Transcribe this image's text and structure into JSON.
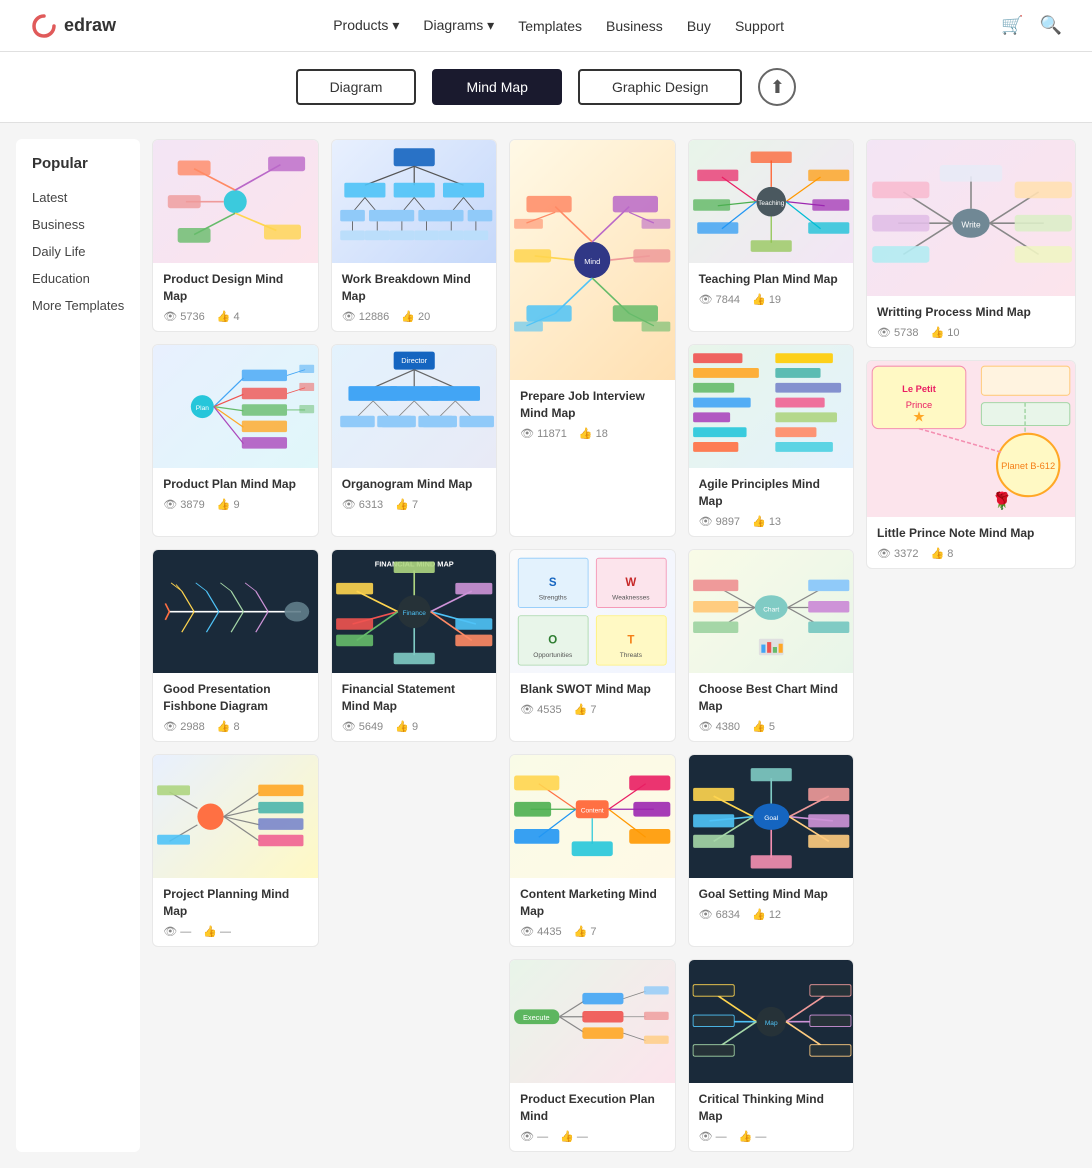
{
  "header": {
    "logo_text": "edraw",
    "nav_items": [
      {
        "label": "Products",
        "has_arrow": true
      },
      {
        "label": "Diagrams",
        "has_arrow": true
      },
      {
        "label": "Templates",
        "has_arrow": false
      },
      {
        "label": "Business",
        "has_arrow": false
      },
      {
        "label": "Buy",
        "has_arrow": false
      },
      {
        "label": "Support",
        "has_arrow": false
      }
    ]
  },
  "tabs": [
    {
      "label": "Diagram",
      "active": false
    },
    {
      "label": "Mind Map",
      "active": true
    },
    {
      "label": "Graphic Design",
      "active": false
    }
  ],
  "sidebar": {
    "title": "Popular",
    "items": [
      {
        "label": "Latest"
      },
      {
        "label": "Business"
      },
      {
        "label": "Daily Life"
      },
      {
        "label": "Education"
      },
      {
        "label": "More Templates"
      }
    ]
  },
  "cards": [
    {
      "id": "work-breakdown",
      "title": "Work Breakdown Mind Map",
      "views": "12886",
      "likes": "20",
      "thumb_type": "work",
      "col": 2
    },
    {
      "id": "prepare-job",
      "title": "Prepare Job Interview Mind Map",
      "views": "11871",
      "likes": "18",
      "thumb_type": "interview",
      "col": 3,
      "tall": true
    },
    {
      "id": "teaching-plan",
      "title": "Teaching Plan Mind Map",
      "views": "7844",
      "likes": "19",
      "thumb_type": "teaching",
      "col": 4
    },
    {
      "id": "agile-principles",
      "title": "Agile Principles Mind Map",
      "views": "9897",
      "likes": "13",
      "thumb_type": "agile",
      "col": 5
    },
    {
      "id": "product-design",
      "title": "Product Design Mind Map",
      "views": "5736",
      "likes": "4",
      "thumb_type": "product-design",
      "col": 1
    },
    {
      "id": "organogram",
      "title": "Organogram Mind Map",
      "views": "6313",
      "likes": "7",
      "thumb_type": "organo",
      "col": 2
    },
    {
      "id": "choose-best",
      "title": "Choose Best Chart Mind Map",
      "views": "4380",
      "likes": "5",
      "thumb_type": "choose",
      "col": 4
    },
    {
      "id": "writing-process",
      "title": "Writting Process Mind Map",
      "views": "5738",
      "likes": "10",
      "thumb_type": "writing",
      "col": 5
    },
    {
      "id": "product-plan",
      "title": "Product Plan Mind Map",
      "views": "3879",
      "likes": "9",
      "thumb_type": "product-plan",
      "col": 1
    },
    {
      "id": "financial-statement",
      "title": "Financial Statement Mind Map",
      "views": "5649",
      "likes": "9",
      "thumb_type": "financial",
      "col": 2
    },
    {
      "id": "blank-swot",
      "title": "Blank SWOT Mind Map",
      "views": "4535",
      "likes": "7",
      "thumb_type": "swot",
      "col": 3
    },
    {
      "id": "goal-setting",
      "title": "Goal Setting Mind Map",
      "views": "6834",
      "likes": "12",
      "thumb_type": "goal",
      "col": 4
    },
    {
      "id": "good-presentation",
      "title": "Good Presentation Fishbone Diagram",
      "views": "2988",
      "likes": "8",
      "thumb_type": "fishbone",
      "col": 1
    },
    {
      "id": "content-marketing",
      "title": "Content Marketing Mind Map",
      "views": "4435",
      "likes": "7",
      "thumb_type": "content",
      "col": 3
    },
    {
      "id": "product-execution",
      "title": "Product Execution Plan Mind",
      "views": "",
      "likes": "",
      "thumb_type": "execution",
      "col": 3,
      "bottom": true
    },
    {
      "id": "project-planning",
      "title": "Project Planning Mind Map",
      "views": "",
      "likes": "",
      "thumb_type": "project",
      "col": 2,
      "bottom": true
    },
    {
      "id": "little-prince",
      "title": "Little Prince Note Mind Map",
      "views": "3372",
      "likes": "8",
      "thumb_type": "little-prince",
      "col": 5
    }
  ]
}
